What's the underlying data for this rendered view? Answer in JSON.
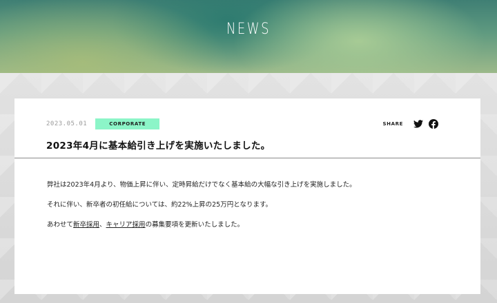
{
  "hero": {
    "title": "NEWS"
  },
  "article": {
    "date": "2023.05.01",
    "category": "CORPORATE",
    "title": "2023年4月に基本給引き上げを実施いたしました。",
    "share_label": "SHARE",
    "share_icons": [
      "twitter-icon",
      "facebook-icon"
    ],
    "paragraphs": [
      "弊社は2023年4月より、物価上昇に伴い、定時昇給だけでなく基本給の大幅な引き上げを実施しました。",
      "それに伴い、新卒者の初任給については、約22%上昇の25万円となります。"
    ],
    "recruit_line": {
      "prefix": "あわせて",
      "link1": "新卒採用",
      "separator": "、",
      "link2": "キャリア採用",
      "suffix": "の募集要項を更新いたしました。"
    }
  },
  "colors": {
    "badge": "#8cf5c8",
    "text": "#111111",
    "date": "#9a9a9a"
  }
}
